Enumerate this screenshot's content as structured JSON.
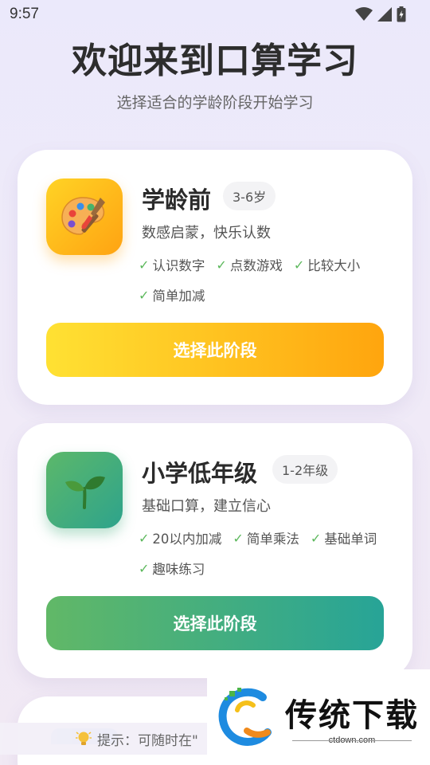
{
  "status_bar": {
    "time": "9:57"
  },
  "header": {
    "title": "欢迎来到口算学习",
    "subtitle": "选择适合的学龄阶段开始学习"
  },
  "cards": [
    {
      "title": "学龄前",
      "age": "3-6岁",
      "description": "数感启蒙，快乐认数",
      "features": [
        "认识数字",
        "点数游戏",
        "比较大小",
        "简单加减"
      ],
      "button_label": "选择此阶段",
      "icon": "palette-icon"
    },
    {
      "title": "小学低年级",
      "age": "1-2年级",
      "description": "基础口算，建立信心",
      "features": [
        "20以内加减",
        "简单乘法",
        "基础单词",
        "趣味练习"
      ],
      "button_label": "选择此阶段",
      "icon": "sprout-icon"
    }
  ],
  "tip": {
    "text": "提示：可随时在\""
  },
  "check_mark": "✓",
  "watermark": {
    "title": "传统下载",
    "url": "ctdown.com"
  },
  "colors": {
    "yellow_start": "#ffe133",
    "yellow_end": "#ffa50e",
    "green_start": "#61b867",
    "green_end": "#27a497",
    "check": "#5cb85c"
  }
}
